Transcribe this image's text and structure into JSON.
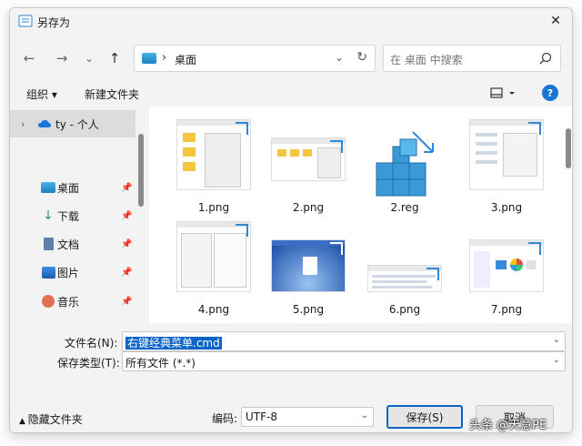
{
  "window": {
    "title": "另存为",
    "close": "✕"
  },
  "nav": {
    "back": "←",
    "forward": "→",
    "history": "⌄",
    "up": "↑",
    "separator": "›",
    "location": "桌面",
    "search_placeholder": "在 桌面 中搜索"
  },
  "toolbar": {
    "organize": "组织 ▾",
    "new_folder": "新建文件夹",
    "help": "?"
  },
  "sidebar": {
    "items": [
      {
        "label": "ty - 个人",
        "icon": "cloud-icon"
      },
      {
        "label": "桌面",
        "icon": "desktop-icon"
      },
      {
        "label": "下载",
        "icon": "download-icon"
      },
      {
        "label": "文档",
        "icon": "document-icon"
      },
      {
        "label": "图片",
        "icon": "pictures-icon"
      },
      {
        "label": "音乐",
        "icon": "music-icon"
      }
    ]
  },
  "files": [
    {
      "name": "1.png"
    },
    {
      "name": "2.png"
    },
    {
      "name": "2.reg"
    },
    {
      "name": "3.png"
    },
    {
      "name": "4.png"
    },
    {
      "name": "5.png"
    },
    {
      "name": "6.png"
    },
    {
      "name": "7.png"
    }
  ],
  "form": {
    "filename_label": "文件名(N):",
    "filename_value": "右键经典菜单.cmd",
    "filetype_label": "保存类型(T):",
    "filetype_value": "所有文件  (*.*)",
    "encoding_label": "编码:",
    "encoding_value": "UTF-8",
    "hide_folders": "隐藏文件夹",
    "save": "保存(S)",
    "cancel": "取消"
  },
  "watermark": "头条 @天意PE",
  "colors": {
    "accent": "#0a64c8",
    "help": "#1976d2"
  }
}
